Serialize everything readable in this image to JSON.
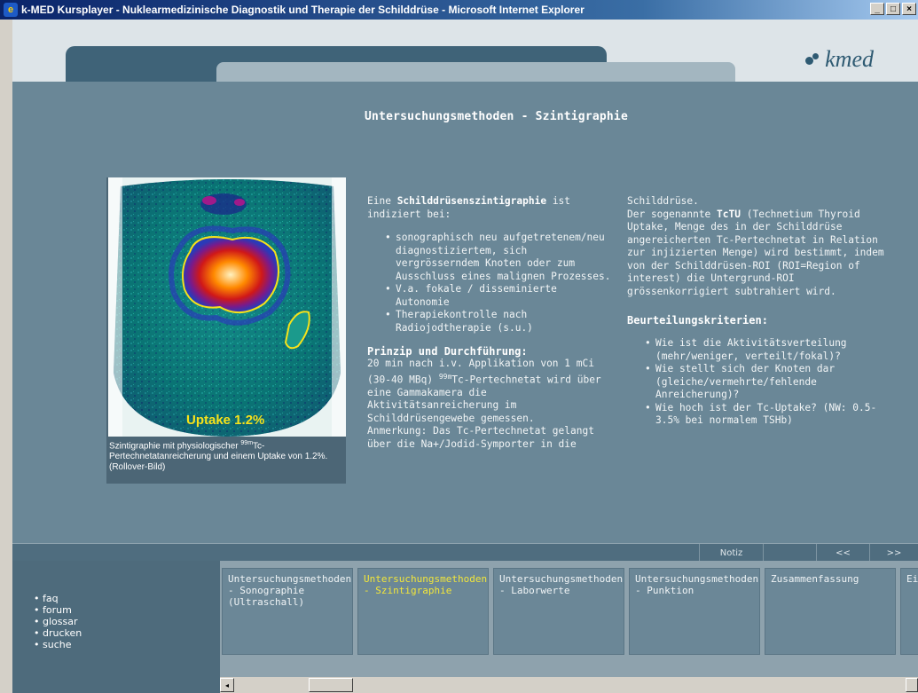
{
  "window": {
    "title": "k-MED Kursplayer - Nuklearmedizinische Diagnostik und Therapie der Schilddrüse - Microsoft Internet Explorer",
    "controls": [
      "_",
      "□",
      "×"
    ]
  },
  "header": {
    "logo_text": "kmed"
  },
  "main": {
    "title": "Untersuchungsmethoden - Szintigraphie",
    "figure": {
      "overlay_label": "Uptake 1.2%",
      "caption_pre": "Szintigraphie mit physiologischer ",
      "caption_sup": "99m",
      "caption_post": "Tc-Pertechnetatanreicherung und einem Uptake von 1.2%. (Rollover-Bild)"
    },
    "col1": {
      "intro_pre": "Eine ",
      "intro_bold": "Schilddrüsenszintigraphie",
      "intro_post": " ist indiziert bei:",
      "indications": [
        "sonographisch neu aufgetretenem/neu diagnostiziertem, sich vergrösserndem Knoten oder zum Ausschluss eines malignen Prozesses.",
        "V.a. fokale / disseminierte Autonomie",
        "Therapiekontrolle nach Radiojodtherapie (s.u.)"
      ],
      "principle_heading": "Prinzip und Durchführung:",
      "principle_pre": "20 min nach i.v. Applikation von 1 mCi (30-40 MBq) ",
      "principle_sup": "99m",
      "principle_post": "Tc-Pertechnetat wird über eine Gammakamera die Aktivitätsanreicherung im Schilddrüsengewebe gemessen.",
      "note": "Anmerkung: Das Tc-Pertechnetat gelangt über die Na+/Jodid-Symporter in die"
    },
    "col2": {
      "cont": "Schilddrüse.",
      "tctu_pre": "Der sogenannte ",
      "tctu_bold": "TcTU",
      "tctu_post": " (Technetium Thyroid Uptake, Menge des in der Schilddrüse angereicherten Tc-Pertechnetat in Relation zur injizierten Menge) wird bestimmt, indem von der Schilddrüsen-ROI (ROI=Region of interest) die Untergrund-ROI grössenkorrigiert subtrahiert wird.",
      "criteria_heading": "Beurteilungskriterien:",
      "criteria": [
        "Wie ist die Aktivitätsverteilung (mehr/weniger, verteilt/fokal)?",
        "Wie stellt sich der Knoten dar (gleiche/vermehrte/fehlende Anreicherung)?",
        "Wie hoch ist der Tc-Uptake? (NW: 0.5-3.5% bei normalem TSHb)"
      ]
    }
  },
  "navstrip": {
    "note": "Notiz",
    "prev": "<<",
    "next": ">>"
  },
  "leftnav": [
    "faq",
    "forum",
    "glossar",
    "drucken",
    "suche"
  ],
  "cards": [
    {
      "label": "Untersuchungsmethoden - Sonographie (Ultraschall)",
      "active": false
    },
    {
      "label": "Untersuchungsmethoden - Szintigraphie",
      "active": true
    },
    {
      "label": "Untersuchungsmethoden - Laborwerte",
      "active": false
    },
    {
      "label": "Untersuchungsmethoden - Punktion",
      "active": false
    },
    {
      "label": "Zusammenfassung",
      "active": false
    },
    {
      "label": "Einstieg",
      "active": false
    }
  ],
  "colors": {
    "accent_active": "#f2e63a",
    "panel": "#6a8797",
    "dark": "#3f6378"
  }
}
